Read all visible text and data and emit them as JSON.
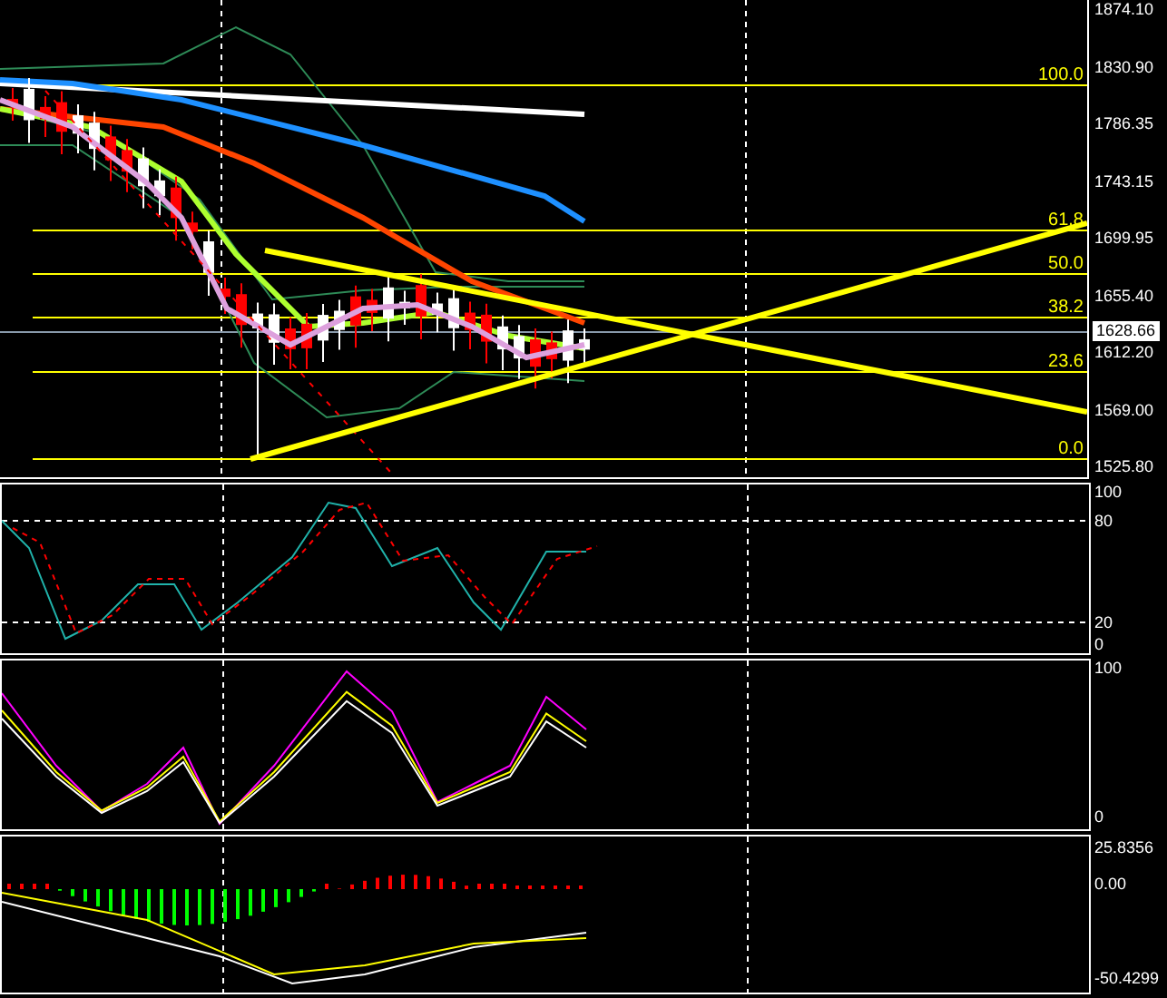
{
  "price_axis": {
    "ticks": [
      "1874.10",
      "1830.90",
      "1786.35",
      "1743.15",
      "1699.95",
      "1655.40",
      "1612.20",
      "1569.00",
      "1525.80"
    ],
    "current_price": "1628.66"
  },
  "fibonacci": {
    "levels": [
      "100.0",
      "61.8",
      "50.0",
      "38.2",
      "23.6",
      "0.0"
    ]
  },
  "stochastic_panel": {
    "axis_labels": [
      "100",
      "80",
      "20",
      "0"
    ]
  },
  "oscillator_panel": {
    "axis_labels": [
      "100",
      "0"
    ]
  },
  "macd_panel": {
    "axis_labels": [
      "25.8356",
      "0.00",
      "-50.4299"
    ]
  }
}
